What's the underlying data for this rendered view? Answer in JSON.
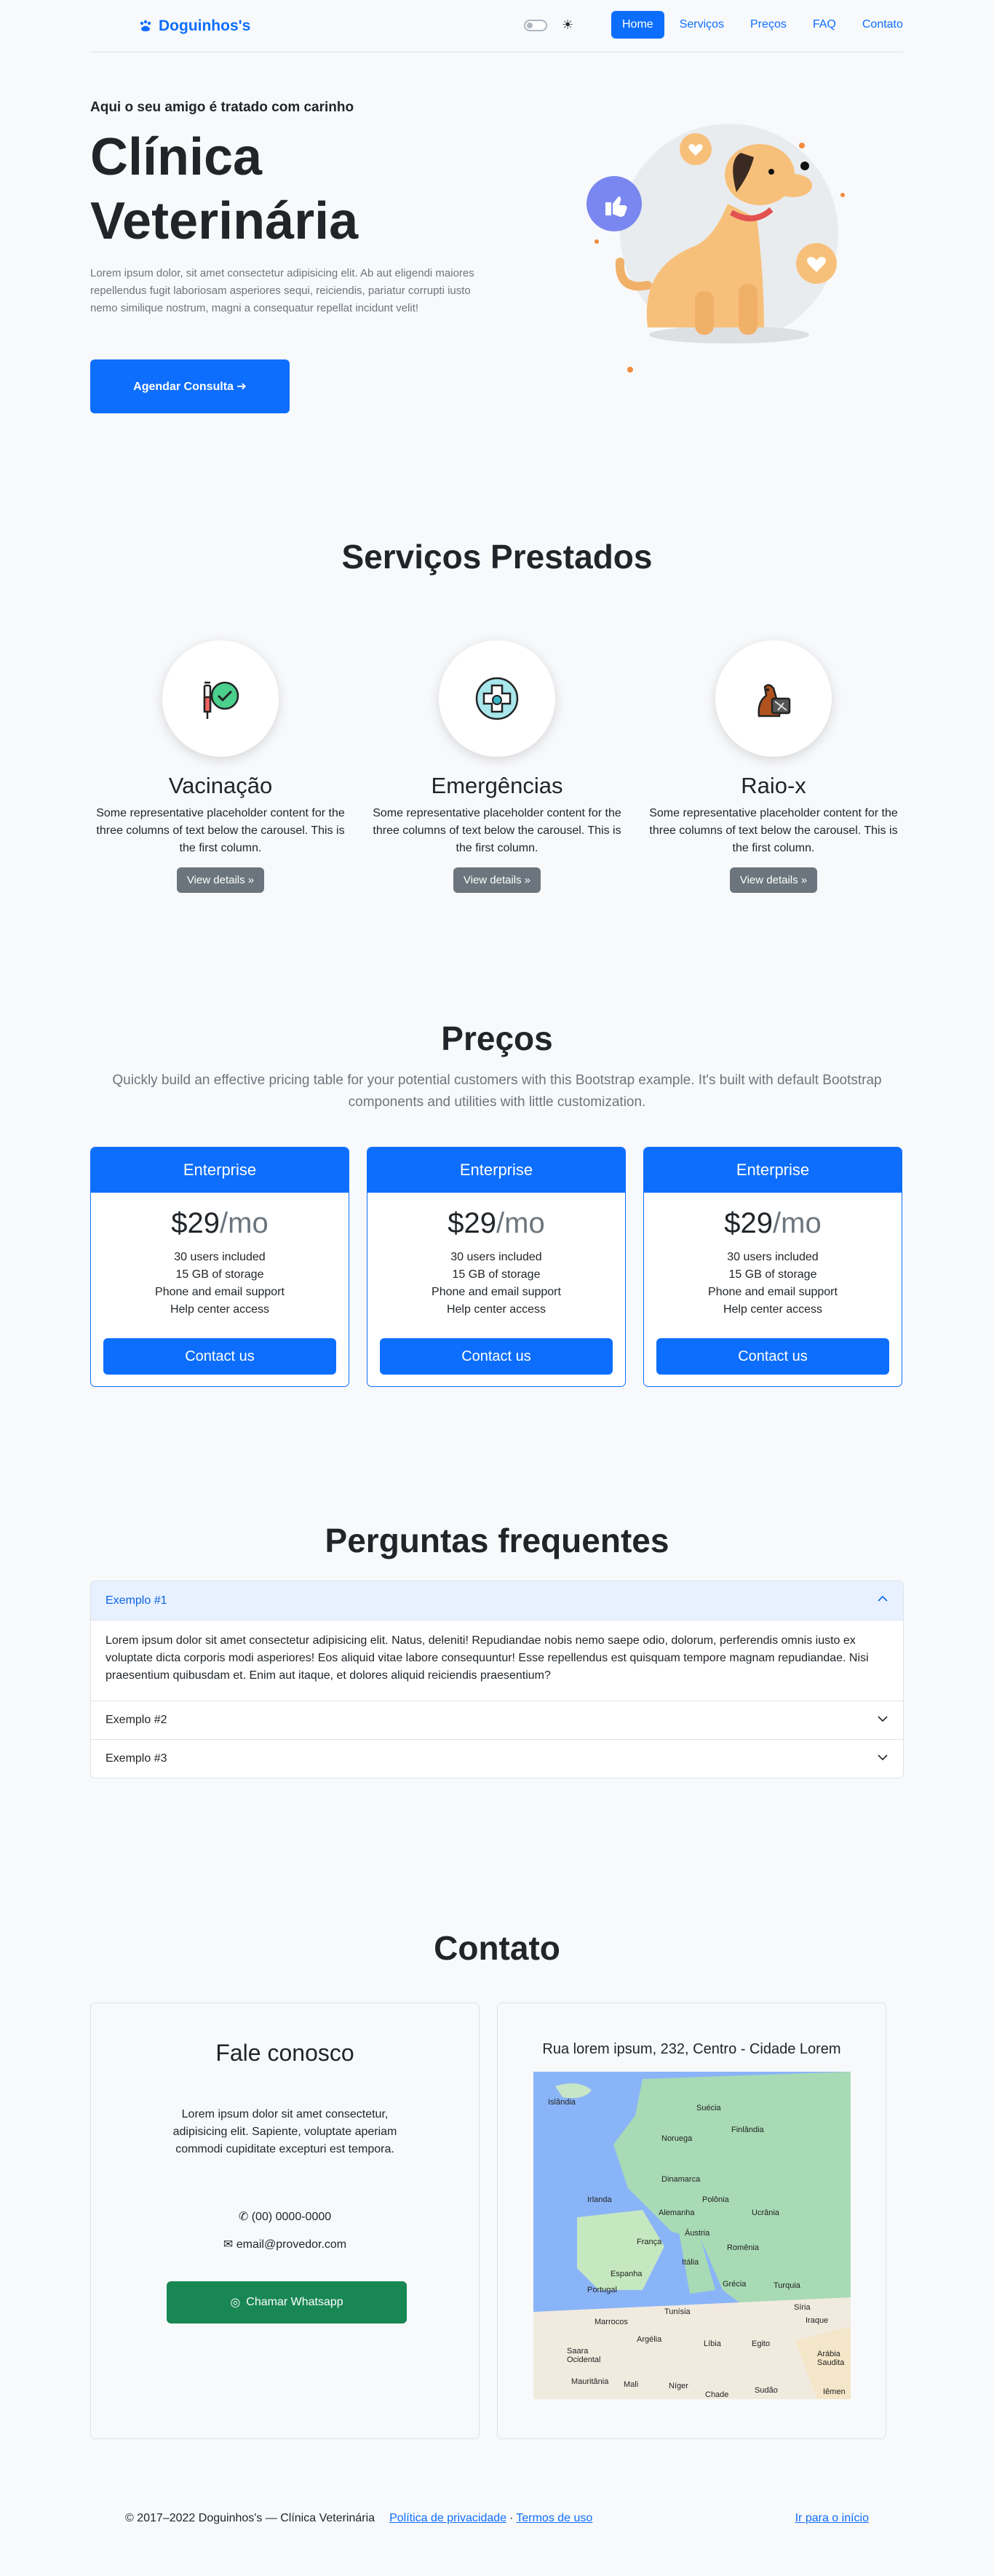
{
  "nav": {
    "brand": "Doguinhos's",
    "links": [
      "Home",
      "Serviços",
      "Preços",
      "FAQ",
      "Contato"
    ]
  },
  "hero": {
    "tagline": "Aqui o seu amigo é tratado com carinho",
    "title": "Clínica Veterinária",
    "text": "Lorem ipsum dolor, sit amet consectetur adipisicing elit. Ab aut eligendi maiores repellendus fugit laboriosam asperiores sequi, reiciendis, pariatur corrupti iusto nemo similique nostrum, magni a consequatur repellat incidunt velit!",
    "button": "Agendar Consulta ➔"
  },
  "services": {
    "title": "Serviços Prestados",
    "items": [
      {
        "name": "Vacinação",
        "text": "Some representative placeholder content for the three columns of text below the carousel. This is the first column.",
        "button": "View details »"
      },
      {
        "name": "Emergências",
        "text": "Some representative placeholder content for the three columns of text below the carousel. This is the first column.",
        "button": "View details »"
      },
      {
        "name": "Raio-x",
        "text": "Some representative placeholder content for the three columns of text below the carousel. This is the first column.",
        "button": "View details »"
      }
    ]
  },
  "pricing": {
    "title": "Preços",
    "subtitle": "Quickly build an effective pricing table for your potential customers with this Bootstrap example. It's built with default Bootstrap components and utilities with little customization.",
    "plans": [
      {
        "name": "Enterprise",
        "price": "$29",
        "period": "/mo",
        "features": [
          "30 users included",
          "15 GB of storage",
          "Phone and email support",
          "Help center access"
        ],
        "button": "Contact us"
      },
      {
        "name": "Enterprise",
        "price": "$29",
        "period": "/mo",
        "features": [
          "30 users included",
          "15 GB of storage",
          "Phone and email support",
          "Help center access"
        ],
        "button": "Contact us"
      },
      {
        "name": "Enterprise",
        "price": "$29",
        "period": "/mo",
        "features": [
          "30 users included",
          "15 GB of storage",
          "Phone and email support",
          "Help center access"
        ],
        "button": "Contact us"
      }
    ]
  },
  "faq": {
    "title": "Perguntas frequentes",
    "items": [
      {
        "question": "Exemplo #1",
        "answer": "Lorem ipsum dolor sit amet consectetur adipisicing elit. Natus, deleniti! Repudiandae nobis nemo saepe odio, dolorum, perferendis omnis iusto ex voluptate dicta corporis modi asperiores! Eos aliquid vitae labore consequuntur! Esse repellendus est quisquam tempore magnam repudiandae. Nisi praesentium quibusdam et. Enim aut itaque, et dolores aliquid reiciendis praesentium?"
      },
      {
        "question": "Exemplo #2"
      },
      {
        "question": "Exemplo #3"
      }
    ]
  },
  "contact": {
    "title": "Contato",
    "heading": "Fale conosco",
    "text": "Lorem ipsum dolor sit amet consectetur, adipisicing elit. Sapiente, voluptate aperiam commodi cupiditate excepturi est tempora.",
    "phone": "(00) 0000-0000",
    "email": "email@provedor.com",
    "whatsapp": "Chamar Whatsapp",
    "address": "Rua lorem ipsum, 232, Centro - Cidade Lorem",
    "map_labels": [
      "Islândia",
      "Suécia",
      "Finlândia",
      "Noruega",
      "Dinamarca",
      "Irlanda",
      "Polônia",
      "Alemanha",
      "Ucrânia",
      "França",
      "Áustria",
      "Romênia",
      "Itália",
      "Espanha",
      "Portugal",
      "Grécia",
      "Turquia",
      "Síria",
      "Marrocos",
      "Tunísia",
      "Iraque",
      "Argélia",
      "Líbia",
      "Egito",
      "Saara Ocidental",
      "Arábia Saudita",
      "Mauritânia",
      "Mali",
      "Níger",
      "Chade",
      "Sudão",
      "Iêmen"
    ]
  },
  "footer": {
    "copyright": "© 2017–2022 Doguinhos's — Clínica Veterinária",
    "privacy": "Política de privacidade",
    "separator": "·",
    "terms": "Termos de uso",
    "top": "Ir para o início"
  },
  "colors": {
    "primary": "#0d6efd",
    "secondary": "#6c757d",
    "success": "#198754",
    "background": "#f8f9fb"
  }
}
